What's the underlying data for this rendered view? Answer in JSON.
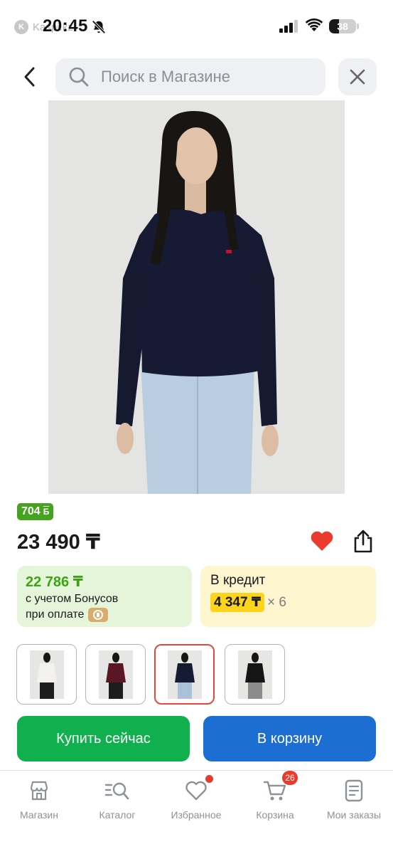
{
  "status_bar": {
    "app_back": "Kaspi.kz",
    "time": "20:45",
    "battery": "38"
  },
  "search": {
    "placeholder": "Поиск в Магазине"
  },
  "product": {
    "bonus_badge": "704",
    "bonus_badge_symbol": "Б",
    "price": "23 490 ₸",
    "bonus_card": {
      "amount": "22 786 ₸",
      "line1": "с учетом Бонусов",
      "line2": "при оплате"
    },
    "credit_card": {
      "title": "В кредит",
      "amount": "4 347 ₸",
      "multiplier": "× 6"
    },
    "thumbnails": [
      {
        "top_color": "#f4f2ee",
        "bottom_color": "#1d1d1d",
        "selected": false
      },
      {
        "top_color": "#5a1624",
        "bottom_color": "#1d1d1d",
        "selected": false
      },
      {
        "top_color": "#161b33",
        "bottom_color": "#a9c1da",
        "selected": true
      },
      {
        "top_color": "#151515",
        "bottom_color": "#8c8c8c",
        "selected": false
      }
    ]
  },
  "actions": {
    "buy_now": "Купить сейчас",
    "add_to_cart": "В корзину"
  },
  "bottom_nav": {
    "items": [
      {
        "label": "Магазин",
        "icon": "store-icon"
      },
      {
        "label": "Каталог",
        "icon": "catalog-search-icon"
      },
      {
        "label": "Избранное",
        "icon": "heart-outline-icon"
      },
      {
        "label": "Корзина",
        "icon": "cart-icon"
      },
      {
        "label": "Мои заказы",
        "icon": "orders-icon"
      }
    ],
    "cart_count": "26"
  },
  "colors": {
    "bonus_green": "#45a31f",
    "buy_green": "#10b04e",
    "cart_blue": "#1c6ed3",
    "favorite_red": "#ea3b2e",
    "credit_yellow": "#fed31c"
  }
}
